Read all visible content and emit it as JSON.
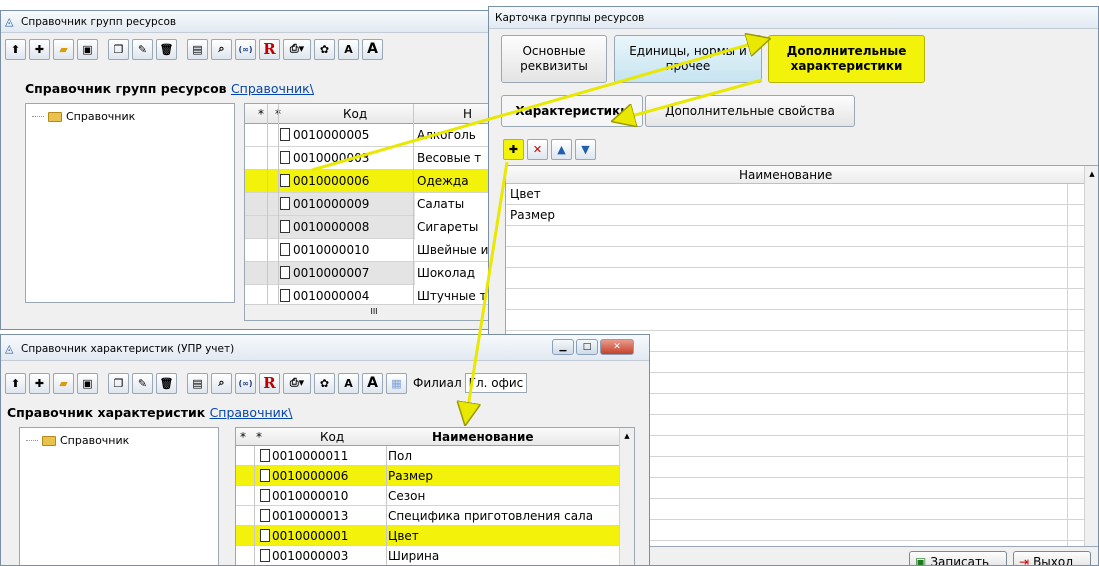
{
  "icons": {
    "toolbar": [
      "arrow-up-icon",
      "new-icon",
      "folder-icon",
      "save-icon",
      "copy-icon",
      "edit-icon",
      "delete-icon",
      "table-icon",
      "binoculars-icon",
      "filter-icon",
      "report-icon",
      "print-icon",
      "dropdown-icon",
      "paint-icon",
      "font-up-icon",
      "font-down-icon",
      "calendar-icon"
    ]
  },
  "toolbar_glyphs": {
    "filter": "(∞)",
    "report": "R",
    "font_small": "A",
    "font_large": "A"
  },
  "colors": {
    "highlight": "#f2f20a",
    "arrow": "#e8e800"
  },
  "groups_window": {
    "title": "Справочник групп ресурсов",
    "heading": "Справочник групп ресурсов",
    "heading_link": "Справочник\\",
    "tree_node": "Справочник",
    "columns": {
      "star1": "*",
      "star2": "*",
      "code": "Код",
      "name": "Н"
    },
    "rows": [
      {
        "code": "0010000005",
        "name": "Алкоголь"
      },
      {
        "code": "0010000003",
        "name": "Весовые т"
      },
      {
        "code": "0010000006",
        "name": "Одежда"
      },
      {
        "code": "0010000009",
        "name": "Салаты"
      },
      {
        "code": "0010000008",
        "name": "Сигареты"
      },
      {
        "code": "0010000010",
        "name": "Швейные и"
      },
      {
        "code": "0010000007",
        "name": "Шоколад"
      },
      {
        "code": "0010000004",
        "name": "Штучные т"
      }
    ],
    "scroll_mark": "III"
  },
  "card_window": {
    "title": "Карточка группы ресурсов",
    "tabs": {
      "main": "Основные реквизиты",
      "units": "Единицы, нормы и прочее",
      "extra": "Дополнительные характеристики"
    },
    "subtabs": {
      "chars": "Характеристики",
      "props": "Дополнительные свойства"
    },
    "column": "Наименование",
    "rows": [
      "Цвет",
      "Размер"
    ],
    "save_button": "Записать",
    "exit_button": "Выход"
  },
  "chars_window": {
    "title": "Справочник характеристик (УПР учет)",
    "filial_label": "Филиал",
    "filial_value": "Гл. офис",
    "heading": "Справочник характеристик",
    "heading_link": "Справочник\\",
    "tree_node": "Справочник",
    "columns": {
      "star1": "*",
      "star2": "*",
      "code": "Код",
      "name": "Наименование"
    },
    "rows": [
      {
        "code": "0010000011",
        "name": "Пол"
      },
      {
        "code": "0010000006",
        "name": "Размер"
      },
      {
        "code": "0010000010",
        "name": "Сезон"
      },
      {
        "code": "0010000013",
        "name": "Специфика приготовления сала"
      },
      {
        "code": "0010000001",
        "name": "Цвет"
      },
      {
        "code": "0010000003",
        "name": "Ширина"
      }
    ]
  }
}
